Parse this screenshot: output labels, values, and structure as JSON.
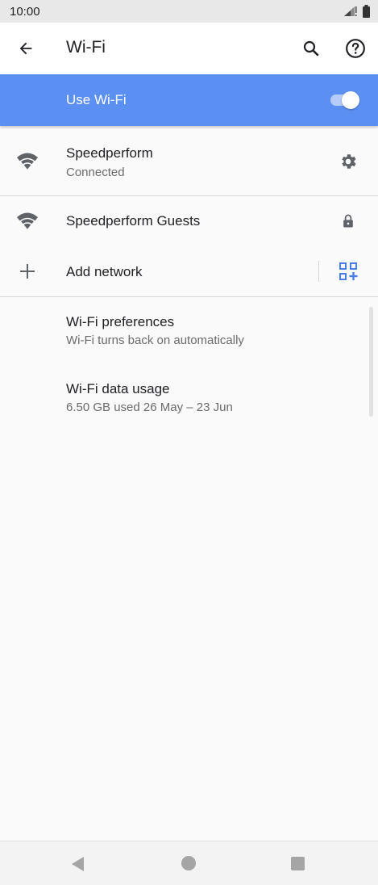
{
  "status_bar": {
    "time": "10:00"
  },
  "app_bar": {
    "title": "Wi-Fi"
  },
  "master_switch": {
    "label": "Use Wi-Fi",
    "state": "on"
  },
  "networks": [
    {
      "ssid": "Speedperform",
      "status": "Connected",
      "right_icon": "gear-icon"
    },
    {
      "ssid": "Speedperform Guests",
      "right_icon": "lock-icon"
    }
  ],
  "add_network": {
    "label": "Add network",
    "right_icon": "qr-code-add-icon"
  },
  "preferences": {
    "title": "Wi-Fi preferences",
    "subtitle": "Wi-Fi turns back on automatically"
  },
  "data_usage": {
    "title": "Wi-Fi data usage",
    "subtitle": "6.50 GB used 26 May – 23 Jun"
  },
  "colors": {
    "accent": "#5c8ff2",
    "icon": "#5f6368",
    "qr": "#4a7ee8"
  }
}
